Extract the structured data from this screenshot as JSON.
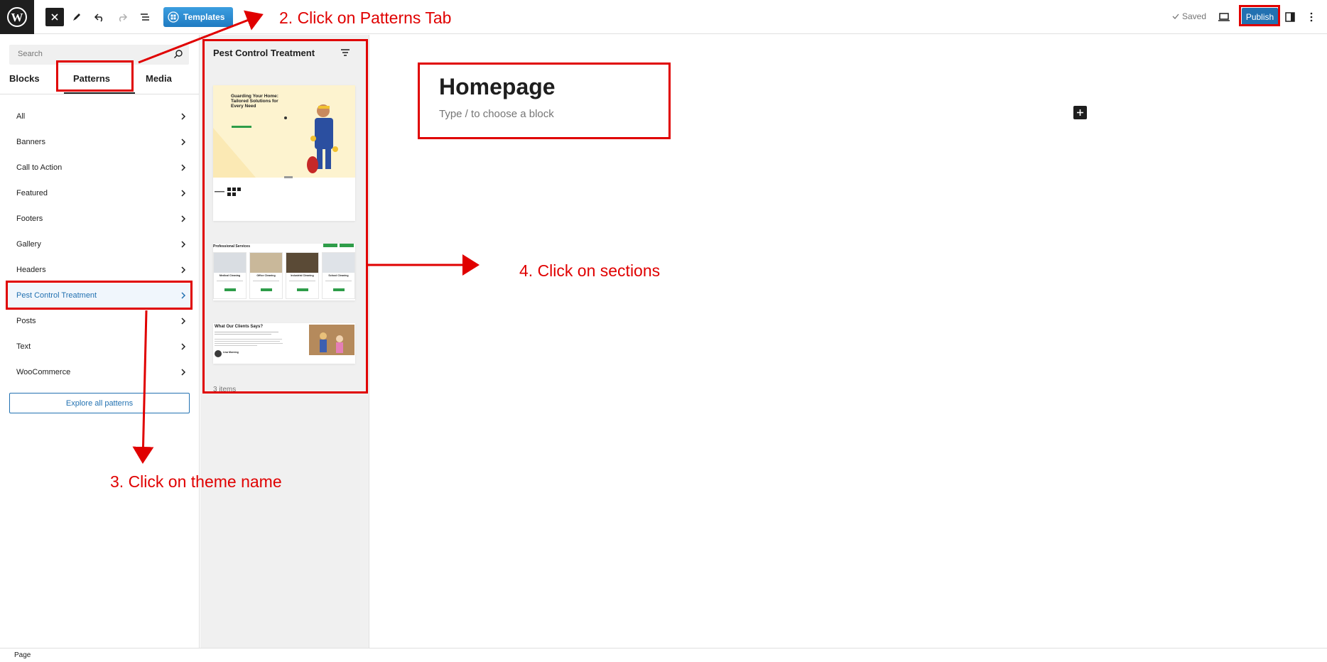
{
  "toolbar": {
    "logo_icon": "wordpress-logo-icon",
    "close_icon": "close-icon",
    "tools_icon": "pen-icon",
    "undo_icon": "undo-icon",
    "redo_icon": "redo-icon",
    "list_view_icon": "list-view-icon",
    "templates_label": "Templates",
    "saved_label": "Saved",
    "preview_icon": "desktop-icon",
    "publish_label": "Publish",
    "settings_icon": "sidebar-icon",
    "more_icon": "more-vertical-icon"
  },
  "inserter": {
    "search_placeholder": "Search",
    "tabs": [
      "Blocks",
      "Patterns",
      "Media"
    ],
    "active_tab": "Patterns",
    "categories": [
      {
        "label": "All"
      },
      {
        "label": "Banners"
      },
      {
        "label": "Call to Action"
      },
      {
        "label": "Featured"
      },
      {
        "label": "Footers"
      },
      {
        "label": "Gallery"
      },
      {
        "label": "Headers"
      },
      {
        "label": "Pest Control Treatment",
        "active": true
      },
      {
        "label": "Posts"
      },
      {
        "label": "Text"
      },
      {
        "label": "WooCommerce"
      }
    ],
    "explore_label": "Explore all patterns"
  },
  "pattern_panel": {
    "title": "Pest Control Treatment",
    "count_label": "3 items",
    "patterns": [
      {
        "heading": "Guarding Your Home: Tailored Solutions for Every Need"
      },
      {
        "heading": "Professional Services",
        "services": [
          "Medical Cleaning",
          "Office Cleaning",
          "Industrial Cleaning",
          "School Cleaning"
        ]
      },
      {
        "heading": "What Our Clients Says?",
        "author": "Lisa Morning"
      }
    ]
  },
  "editor": {
    "page_title": "Homepage",
    "block_placeholder": "Type / to choose a block"
  },
  "statusbar": {
    "label": "Page"
  },
  "annotations": {
    "step2": "2. Click on Patterns Tab",
    "step3": "3. Click on theme name",
    "step4": "4. Click on sections",
    "color": "#e00000"
  },
  "colors": {
    "accent": "#2271b1",
    "dark": "#1e1e1e",
    "annotation": "#e00000"
  }
}
